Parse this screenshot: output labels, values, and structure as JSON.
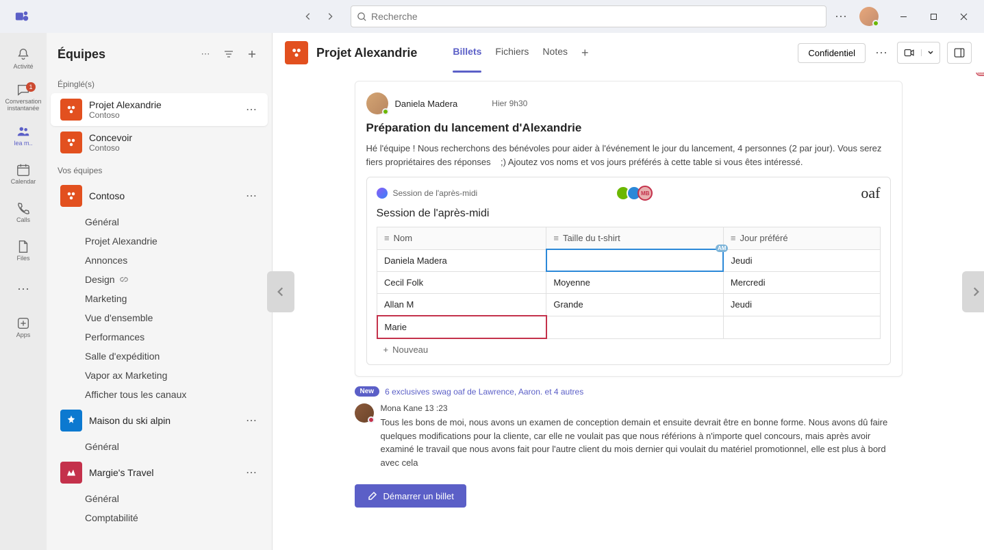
{
  "search": {
    "placeholder": "Recherche"
  },
  "rail": {
    "activity": "Activité",
    "chat": "Conversation instantanée",
    "chat_badge": "1",
    "teams": "lea m..",
    "calendar": "Calendar",
    "calls": "Calls",
    "files": "Files",
    "apps": "Apps"
  },
  "sidebar": {
    "title": "Équipes",
    "section_pinned": "Épinglé(s)",
    "section_yours": "Vos équipes",
    "pinned": [
      {
        "name": "Projet Alexandrie",
        "sub": "Contoso"
      },
      {
        "name": "Concevoir",
        "sub": "Contoso"
      }
    ],
    "teams": [
      {
        "name": "Contoso",
        "channels": [
          "Général",
          "Projet Alexandrie",
          "Annonces",
          "Design",
          "Marketing",
          "Vue d'ensemble",
          "Performances",
          "Salle d'expédition",
          "Vapor ax Marketing",
          "Afficher tous les canaux"
        ]
      },
      {
        "name": "Maison du ski alpin",
        "channels": [
          "Général"
        ]
      },
      {
        "name": "Margie's Travel",
        "channels": [
          "Général",
          "Comptabilité"
        ]
      }
    ]
  },
  "header": {
    "title": "Projet Alexandrie",
    "tabs": {
      "posts": "Billets",
      "files": "Fichiers",
      "notes": "Notes",
      "add": "+"
    },
    "confidential": "Confidentiel"
  },
  "post": {
    "author": "Daniela Madera",
    "time": "Hier 9h30",
    "title": "Préparation du lancement d'Alexandrie",
    "body": "Hé l'équipe ! Nous recherchons des bénévoles pour aider à l'événement le jour du lancement, 4 personnes (2 par jour). Vous serez fiers propriétaires des réponses    ;) Ajoutez vos noms et vos jours préférés à cette table si vous êtes intéressé."
  },
  "card": {
    "top_label": "Session de l'après-midi",
    "oaf": "oaf",
    "title": "Session de l'après-midi",
    "mb_badge": "MB",
    "am_badge": "AM",
    "cols": {
      "name": "Nom",
      "size": "Taille du t-shirt",
      "day": "Jour préféré"
    },
    "rows": [
      {
        "name": "Daniela Madera",
        "size": "",
        "day": "Jeudi"
      },
      {
        "name": "Cecil Folk",
        "size": "Moyenne",
        "day": "Mercredi"
      },
      {
        "name": "Allan M",
        "size": "Grande",
        "day": "Jeudi"
      },
      {
        "name": "Marie",
        "size": "",
        "day": ""
      }
    ],
    "add_row": "Nouveau"
  },
  "replies": {
    "new": "New",
    "summary": "6  exclusives swag oaf de Lawrence, Aaron. et 4 autres"
  },
  "reply": {
    "head": "Mona Kane 13 :23",
    "text": "Tous les bons de moi, nous avons un examen de conception demain et ensuite devrait être en bonne forme. Nous avons dû faire quelques modifications pour la cliente, car elle ne voulait pas que nous référions à n'importe quel concours, mais après avoir examiné le travail que nous avons fait pour l'autre client du mois dernier qui voulait du matériel promotionnel, elle est plus à bord avec cela"
  },
  "compose": {
    "label": "Démarrer un billet"
  }
}
